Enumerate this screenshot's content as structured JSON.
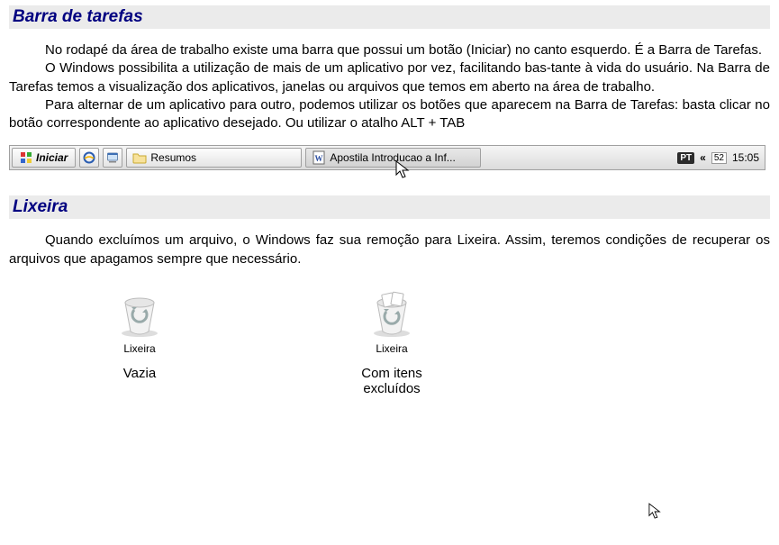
{
  "section1": {
    "title": "Barra de tarefas",
    "p1": "No rodapé da área de trabalho existe uma barra que possui um botão (Iniciar) no canto esquerdo. É a Barra de Tarefas.",
    "p2": "O Windows possibilita a utilização de mais de um aplicativo por vez, facilitando bas-tante à vida do usuário. Na Barra de Tarefas temos a visualização dos aplicativos, janelas ou arquivos que temos em aberto na área de trabalho.",
    "p3": "Para alternar de um aplicativo para outro, podemos utilizar os botões que aparecem na Barra de Tarefas: basta clicar no botão correspondente ao aplicativo desejado. Ou utilizar o atalho ALT + TAB"
  },
  "taskbar": {
    "start": "Iniciar",
    "task1": "Resumos",
    "task2": "Apostila Introducao a Inf...",
    "tray_lang": "PT",
    "tray_chev": "«",
    "tray_temp": "52",
    "tray_time": "15:05"
  },
  "section2": {
    "title": "Lixeira",
    "p1": "Quando excluímos um arquivo, o Windows faz sua remoção para Lixeira.  Assim, teremos condições de recuperar os arquivos que apagamos sempre que necessário."
  },
  "lixeira": {
    "icon_label": "Lixeira",
    "caption_empty": "Vazia",
    "caption_full_line1": "Com itens",
    "caption_full_line2": "excluídos"
  }
}
